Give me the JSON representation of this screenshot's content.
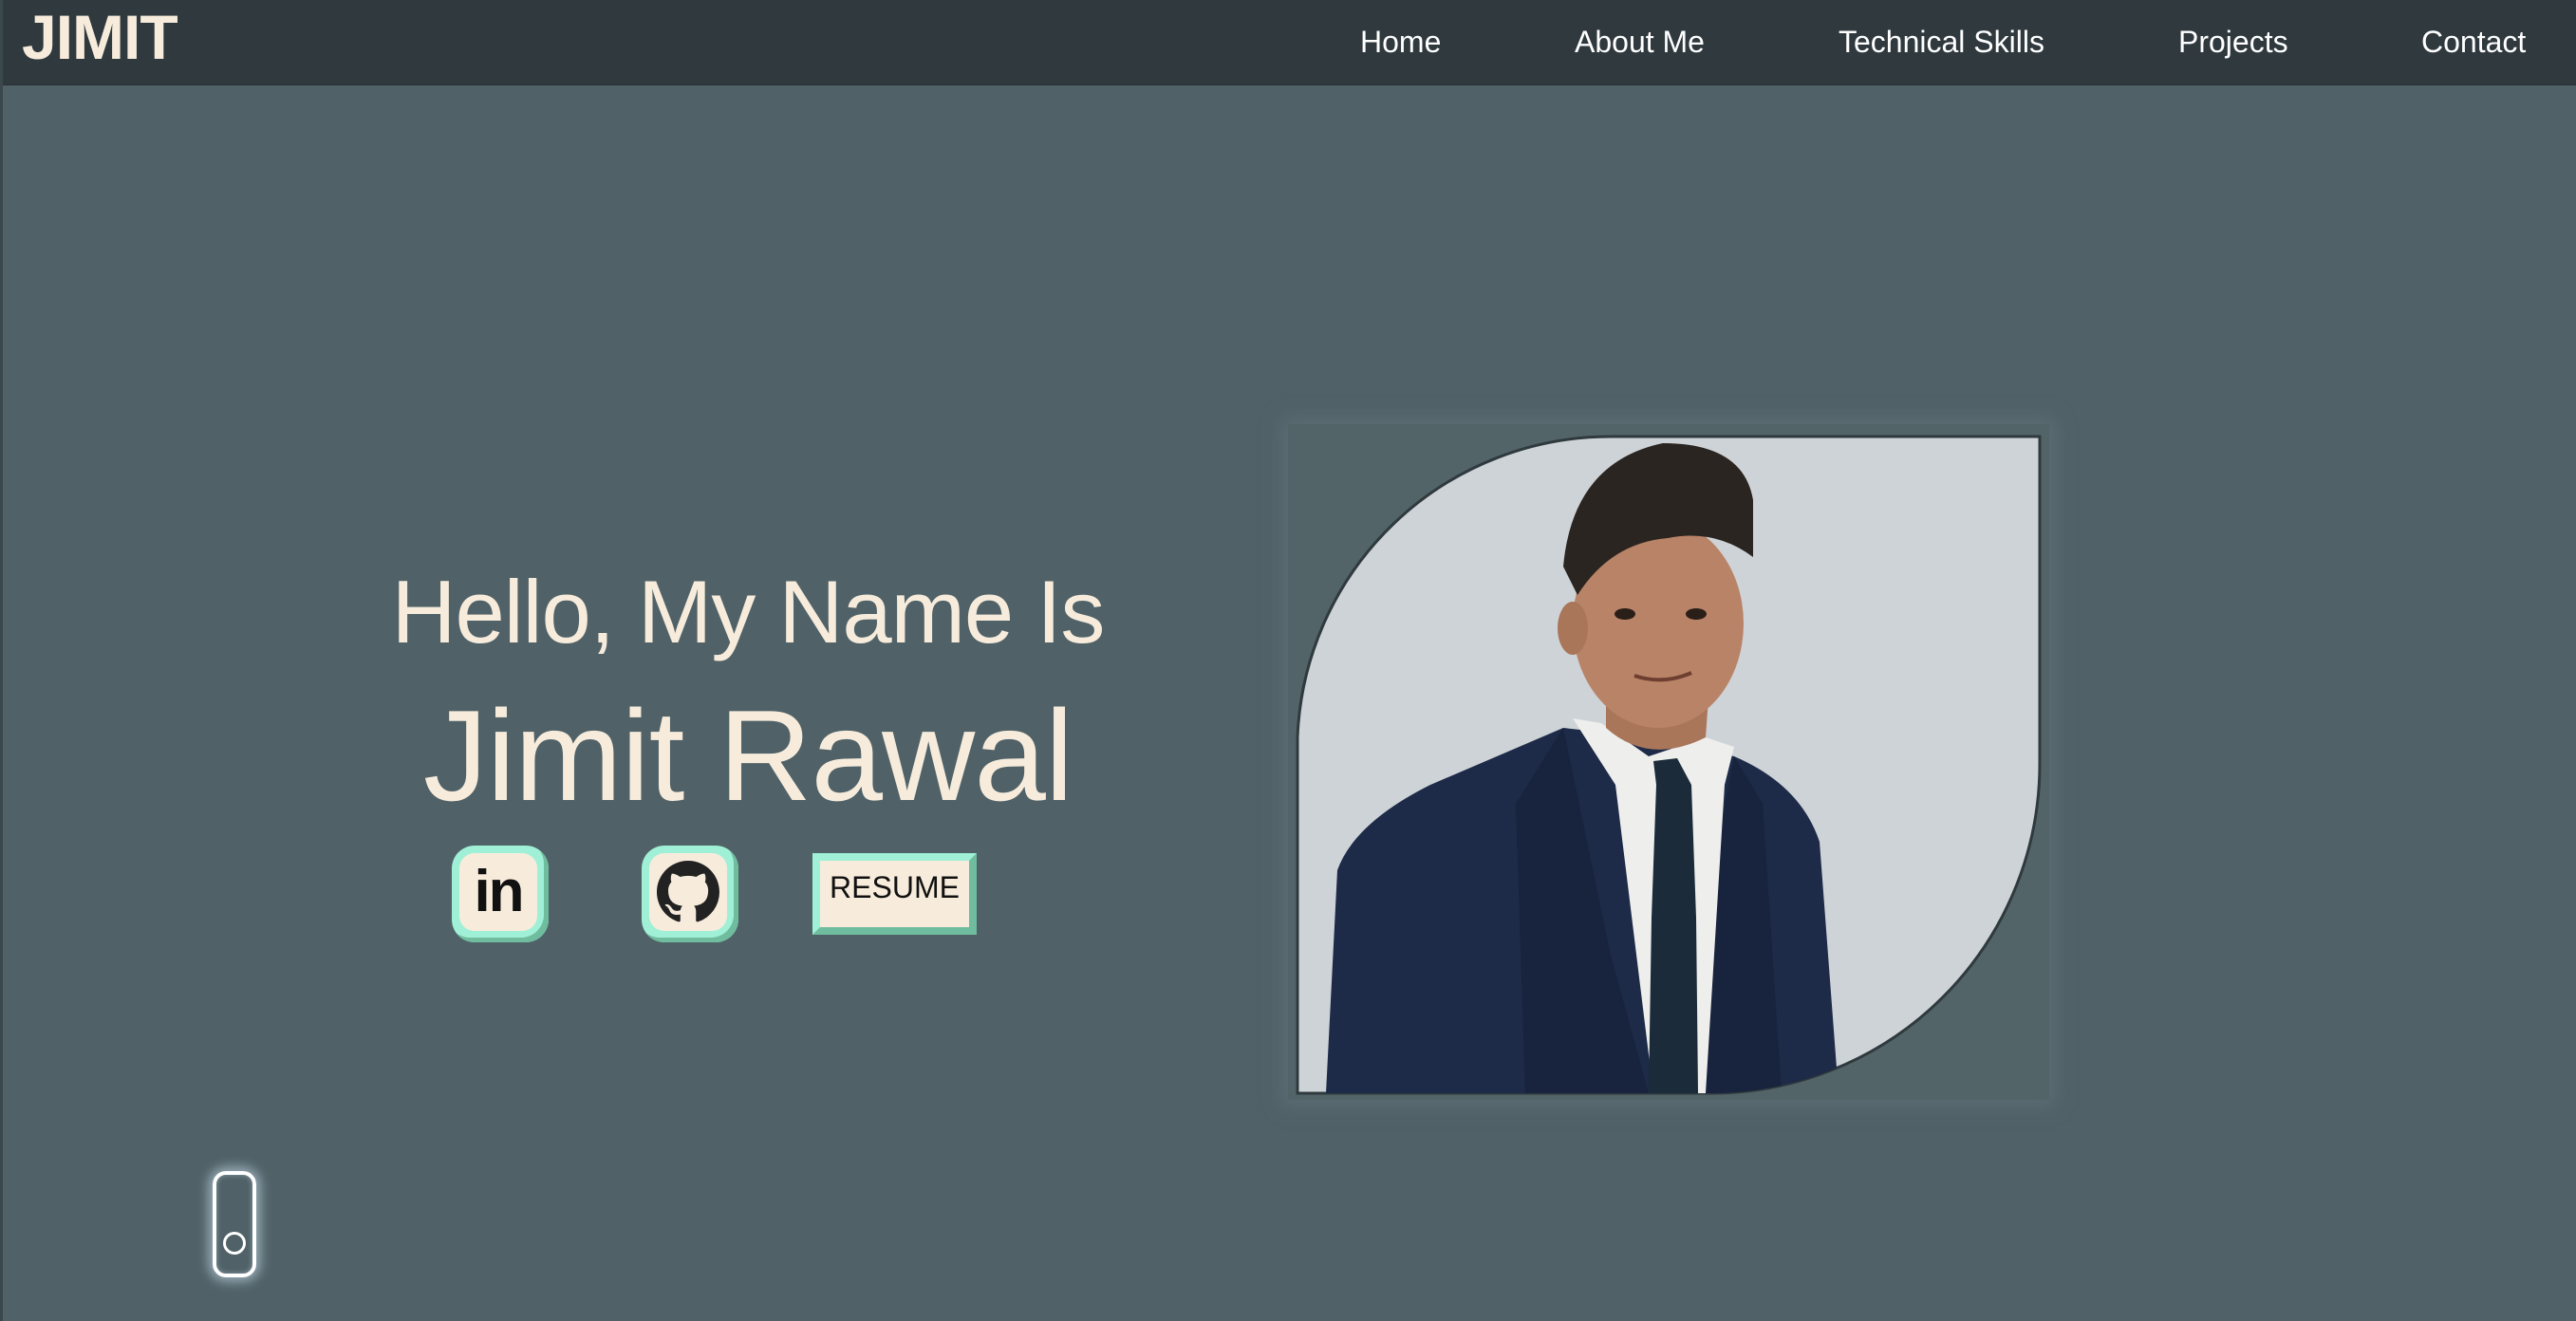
{
  "header": {
    "logo": "JIMIT",
    "nav": [
      {
        "label": "Home"
      },
      {
        "label": "About Me"
      },
      {
        "label": "Technical Skills"
      },
      {
        "label": "Projects"
      },
      {
        "label": "Contact"
      }
    ]
  },
  "hero": {
    "greeting": "Hello, My Name Is",
    "name": "Jimit Rawal",
    "social": [
      {
        "icon": "linkedin-icon",
        "text": "in"
      },
      {
        "icon": "github-icon"
      }
    ],
    "resume_label": "RESUME",
    "photo_icon": "profile-photo"
  },
  "theme_toggle": {
    "icon": "toggle-switch"
  },
  "colors": {
    "background": "#506268",
    "navbar": "#2f393e",
    "text_cream": "#f7ecdc",
    "accent_mint": "#9ff0d6",
    "accent_mint_dark": "#6fbc9f"
  }
}
